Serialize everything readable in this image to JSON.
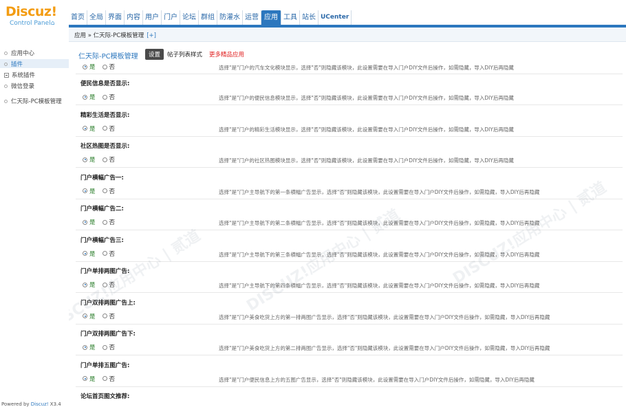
{
  "logo": {
    "brand": "Discuz!",
    "subtitle": "Control Panel"
  },
  "topnav": [
    "首页",
    "全局",
    "界面",
    "内容",
    "用户",
    "门户",
    "论坛",
    "群组",
    "防灌水",
    "运营",
    "应用",
    "工具",
    "站长",
    "UCenter"
  ],
  "sidebar": {
    "items": [
      "应用中心",
      "插件",
      "系统插件",
      "微信登录",
      "仁天际-PC模板管理"
    ],
    "powered_prefix": "Powered by ",
    "powered_link": "Discuz!",
    "powered_version": " X3.4"
  },
  "breadcrumb": {
    "text": "应用 » 仁天际-PC模板管理",
    "plus": "[+]"
  },
  "header": {
    "title": "仁天际-PC模板管理",
    "tab_settings": "设置",
    "tab_styles": "帖子列表样式",
    "tab_more": "更多精品应用"
  },
  "radio": {
    "yes": "是",
    "no": "否"
  },
  "rows": [
    {
      "label": "",
      "desc": "选择\"是\"门户的汽车文化模块显示，选择\"否\"则隐藏该模块，此设置需要在导入门户DIY文件后操作，如需隐藏，导入DIY后再隐藏"
    },
    {
      "label": "便民信息是否显示:",
      "desc": "选择\"是\"门户的便民信息模块显示，选择\"否\"则隐藏该模块，此设置需要在导入门户DIY文件后操作，如需隐藏，导入DIY后再隐藏"
    },
    {
      "label": "精彩生活是否显示:",
      "desc": "选择\"是\"门户的精彩生活模块显示，选择\"否\"则隐藏该模块，此设置需要在导入门户DIY文件后操作，如需隐藏，导入DIY后再隐藏"
    },
    {
      "label": "社区热图是否显示:",
      "desc": "选择\"是\"门户的社区热图模块显示，选择\"否\"则隐藏该模块，此设置需要在导入门户DIY文件后操作，如需隐藏，导入DIY后再隐藏"
    },
    {
      "label": "门户横幅广告一:",
      "desc": "选择\"是\"门户主导航下的第一条横幅广告显示，选择\"否\"则隐藏该模块，此设置需要在导入门户DIY文件后操作，如需隐藏，导入DIY后再隐藏"
    },
    {
      "label": "门户横幅广告二:",
      "desc": "选择\"是\"门户主导航下的第二条横幅广告显示，选择\"否\"则隐藏该模块，此设置需要在导入门户DIY文件后操作，如需隐藏，导入DIY后再隐藏"
    },
    {
      "label": "门户横幅广告三:",
      "desc": "选择\"是\"门户主导航下的第三条横幅广告显示，选择\"否\"则隐藏该模块，此设置需要在导入门户DIY文件后操作，如需隐藏，导入DIY后再隐藏"
    },
    {
      "label": "门户单排两图广告:",
      "desc": "选择\"是\"门户主导航下的第四条横幅广告显示，选择\"否\"则隐藏该模块，此设置需要在导入门户DIY文件后操作，如需隐藏，导入DIY后再隐藏"
    },
    {
      "label": "门户双排两图广告上:",
      "desc": "选择\"是\"门户美食吃货上方的第一排两图广告显示，选择\"否\"则隐藏该模块，此设置需要在导入门户DIY文件后操作，如需隐藏，导入DIY后再隐藏"
    },
    {
      "label": "门户双排两图广告下:",
      "desc": "选择\"是\"门户美食吃货上方的第二排两图广告显示，选择\"否\"则隐藏该模块，此设置需要在导入门户DIY文件后操作，如需隐藏，导入DIY后再隐藏"
    },
    {
      "label": "门户单排五图广告:",
      "desc": "选择\"是\"门户便民信息上方的五图广告显示，选择\"否\"则隐藏该模块，此设置需要在导入门户DIY文件后操作，如需隐藏，导入DIY后再隐藏"
    },
    {
      "label": "论坛首页图文推荐:",
      "desc": ""
    }
  ]
}
